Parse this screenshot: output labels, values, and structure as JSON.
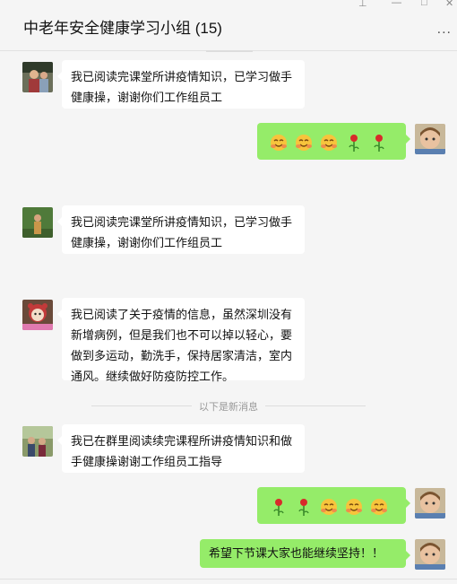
{
  "window": {
    "title": "中老年安全健康学习小组 (15)",
    "more_label": "..."
  },
  "divider_text": "以下是新消息",
  "messages": [
    {
      "side": "left",
      "text": "我已阅读完课堂所讲疫情知识，已学习做手健康操，谢谢你们工作组员工"
    },
    {
      "side": "right",
      "emojis": [
        "smile-blush-emoji",
        "smile-blush-emoji",
        "smile-blush-emoji",
        "rose-emoji",
        "rose-emoji"
      ]
    },
    {
      "side": "left",
      "text": "我已阅读完课堂所讲疫情知识，已学习做手健康操，谢谢你们工作组员工"
    },
    {
      "side": "left",
      "text": "我已阅读了关于疫情的信息，虽然深圳没有新增病例，但是我们也不可以掉以轻心，要做到多运动，勤洗手，保持居家清洁，室内通风。继续做好防疫防控工作。"
    },
    {
      "side": "left",
      "text": "我已在群里阅读续完课程所讲疫情知识和做手健康操谢谢工作组员工指导"
    },
    {
      "side": "right",
      "emojis": [
        "rose-emoji",
        "rose-emoji",
        "smile-blush-emoji",
        "smile-blush-emoji",
        "smile-blush-emoji"
      ]
    },
    {
      "side": "right",
      "text": "希望下节课大家也能继续坚持！！"
    }
  ]
}
